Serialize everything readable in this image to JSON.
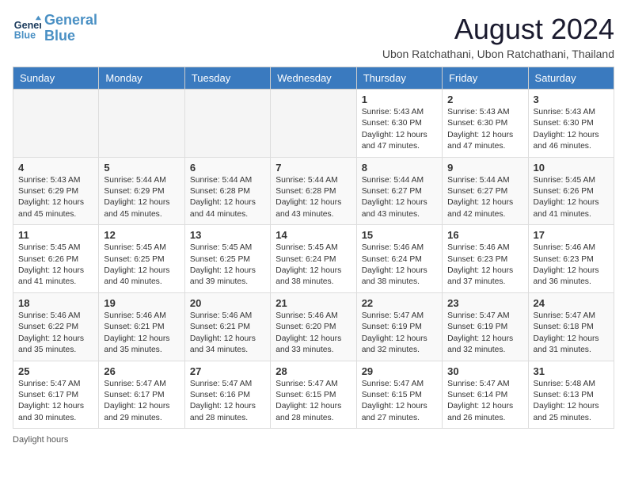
{
  "header": {
    "logo_line1": "General",
    "logo_line2": "Blue",
    "month_year": "August 2024",
    "location": "Ubon Ratchathani, Ubon Ratchathani, Thailand"
  },
  "columns": [
    "Sunday",
    "Monday",
    "Tuesday",
    "Wednesday",
    "Thursday",
    "Friday",
    "Saturday"
  ],
  "weeks": [
    [
      {
        "day": "",
        "info": ""
      },
      {
        "day": "",
        "info": ""
      },
      {
        "day": "",
        "info": ""
      },
      {
        "day": "",
        "info": ""
      },
      {
        "day": "1",
        "info": "Sunrise: 5:43 AM\nSunset: 6:30 PM\nDaylight: 12 hours\nand 47 minutes."
      },
      {
        "day": "2",
        "info": "Sunrise: 5:43 AM\nSunset: 6:30 PM\nDaylight: 12 hours\nand 47 minutes."
      },
      {
        "day": "3",
        "info": "Sunrise: 5:43 AM\nSunset: 6:30 PM\nDaylight: 12 hours\nand 46 minutes."
      }
    ],
    [
      {
        "day": "4",
        "info": "Sunrise: 5:43 AM\nSunset: 6:29 PM\nDaylight: 12 hours\nand 45 minutes."
      },
      {
        "day": "5",
        "info": "Sunrise: 5:44 AM\nSunset: 6:29 PM\nDaylight: 12 hours\nand 45 minutes."
      },
      {
        "day": "6",
        "info": "Sunrise: 5:44 AM\nSunset: 6:28 PM\nDaylight: 12 hours\nand 44 minutes."
      },
      {
        "day": "7",
        "info": "Sunrise: 5:44 AM\nSunset: 6:28 PM\nDaylight: 12 hours\nand 43 minutes."
      },
      {
        "day": "8",
        "info": "Sunrise: 5:44 AM\nSunset: 6:27 PM\nDaylight: 12 hours\nand 43 minutes."
      },
      {
        "day": "9",
        "info": "Sunrise: 5:44 AM\nSunset: 6:27 PM\nDaylight: 12 hours\nand 42 minutes."
      },
      {
        "day": "10",
        "info": "Sunrise: 5:45 AM\nSunset: 6:26 PM\nDaylight: 12 hours\nand 41 minutes."
      }
    ],
    [
      {
        "day": "11",
        "info": "Sunrise: 5:45 AM\nSunset: 6:26 PM\nDaylight: 12 hours\nand 41 minutes."
      },
      {
        "day": "12",
        "info": "Sunrise: 5:45 AM\nSunset: 6:25 PM\nDaylight: 12 hours\nand 40 minutes."
      },
      {
        "day": "13",
        "info": "Sunrise: 5:45 AM\nSunset: 6:25 PM\nDaylight: 12 hours\nand 39 minutes."
      },
      {
        "day": "14",
        "info": "Sunrise: 5:45 AM\nSunset: 6:24 PM\nDaylight: 12 hours\nand 38 minutes."
      },
      {
        "day": "15",
        "info": "Sunrise: 5:46 AM\nSunset: 6:24 PM\nDaylight: 12 hours\nand 38 minutes."
      },
      {
        "day": "16",
        "info": "Sunrise: 5:46 AM\nSunset: 6:23 PM\nDaylight: 12 hours\nand 37 minutes."
      },
      {
        "day": "17",
        "info": "Sunrise: 5:46 AM\nSunset: 6:23 PM\nDaylight: 12 hours\nand 36 minutes."
      }
    ],
    [
      {
        "day": "18",
        "info": "Sunrise: 5:46 AM\nSunset: 6:22 PM\nDaylight: 12 hours\nand 35 minutes."
      },
      {
        "day": "19",
        "info": "Sunrise: 5:46 AM\nSunset: 6:21 PM\nDaylight: 12 hours\nand 35 minutes."
      },
      {
        "day": "20",
        "info": "Sunrise: 5:46 AM\nSunset: 6:21 PM\nDaylight: 12 hours\nand 34 minutes."
      },
      {
        "day": "21",
        "info": "Sunrise: 5:46 AM\nSunset: 6:20 PM\nDaylight: 12 hours\nand 33 minutes."
      },
      {
        "day": "22",
        "info": "Sunrise: 5:47 AM\nSunset: 6:19 PM\nDaylight: 12 hours\nand 32 minutes."
      },
      {
        "day": "23",
        "info": "Sunrise: 5:47 AM\nSunset: 6:19 PM\nDaylight: 12 hours\nand 32 minutes."
      },
      {
        "day": "24",
        "info": "Sunrise: 5:47 AM\nSunset: 6:18 PM\nDaylight: 12 hours\nand 31 minutes."
      }
    ],
    [
      {
        "day": "25",
        "info": "Sunrise: 5:47 AM\nSunset: 6:17 PM\nDaylight: 12 hours\nand 30 minutes."
      },
      {
        "day": "26",
        "info": "Sunrise: 5:47 AM\nSunset: 6:17 PM\nDaylight: 12 hours\nand 29 minutes."
      },
      {
        "day": "27",
        "info": "Sunrise: 5:47 AM\nSunset: 6:16 PM\nDaylight: 12 hours\nand 28 minutes."
      },
      {
        "day": "28",
        "info": "Sunrise: 5:47 AM\nSunset: 6:15 PM\nDaylight: 12 hours\nand 28 minutes."
      },
      {
        "day": "29",
        "info": "Sunrise: 5:47 AM\nSunset: 6:15 PM\nDaylight: 12 hours\nand 27 minutes."
      },
      {
        "day": "30",
        "info": "Sunrise: 5:47 AM\nSunset: 6:14 PM\nDaylight: 12 hours\nand 26 minutes."
      },
      {
        "day": "31",
        "info": "Sunrise: 5:48 AM\nSunset: 6:13 PM\nDaylight: 12 hours\nand 25 minutes."
      }
    ]
  ],
  "footer": "Daylight hours"
}
